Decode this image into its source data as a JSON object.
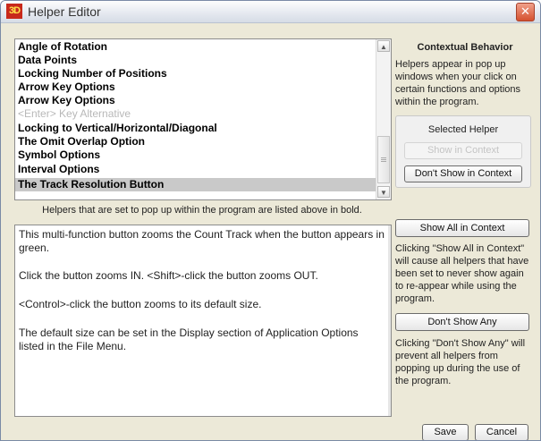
{
  "window": {
    "logo": "3D",
    "title": "Helper Editor",
    "close_glyph": "✕"
  },
  "helper_list": {
    "items": [
      "Angle of Rotation",
      "Data Points",
      "Locking Number of Positions",
      "Arrow Key Options",
      "Arrow Key Options",
      "<Enter> Key Alternative",
      "Locking to Vertical/Horizontal/Diagonal",
      "The Omit Overlap Option",
      "Symbol Options",
      "Interval Options",
      "The Track Resolution Button"
    ],
    "selected_index": 10,
    "caption": "Helpers that are set to pop up within the program are listed above in bold."
  },
  "description": {
    "paragraphs": [
      "This multi-function button zooms the Count Track when the button appears in green.",
      "Click the button zooms IN.  <Shift>-click the button zooms OUT.",
      "<Control>-click the button zooms to its default size.",
      "The default size can be set in the Display section of Application Options listed in the File Menu."
    ]
  },
  "contextual": {
    "title": "Contextual Behavior",
    "text": "Helpers appear in pop up windows when your click on certain functions and options within the program.",
    "selected_label": "Selected Helper",
    "show_in_context": "Show in Context",
    "dont_show_in_context": "Don't Show in Context",
    "show_all": "Show All in Context",
    "show_all_text": "Clicking \"Show All in Context\" will cause all helpers that have been set to never show again to re-appear while using the program.",
    "dont_show_any": "Don't Show Any",
    "dont_show_any_text": "Clicking \"Don't Show Any\" will prevent all helpers from popping up during the use of the program."
  },
  "footer": {
    "save": "Save",
    "cancel": "Cancel"
  },
  "icons": {
    "scroll_up": "scroll-up-icon",
    "scroll_down": "scroll-down-icon",
    "close": "close-icon"
  },
  "colors": {
    "logo_bg": "#c8281a",
    "logo_fg": "#ffe14a",
    "close_bg": "#d5512f",
    "selection": "#c9c9c9",
    "disabled_text": "#c4c4c4"
  }
}
